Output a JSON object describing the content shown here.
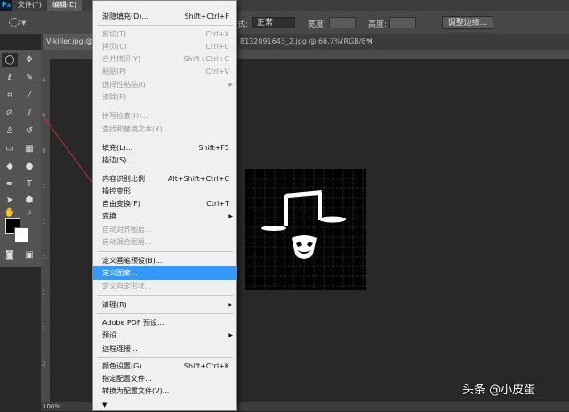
{
  "app": {
    "logo": "Ps"
  },
  "menubar": {
    "items": [
      "文件(F)",
      "编辑(E)"
    ]
  },
  "options": {
    "style_label": "样式:",
    "style_value": "正常",
    "width_label": "宽度:",
    "height_label": "高度:",
    "refine_button": "调整边缘..."
  },
  "document": {
    "tab_title": "V-killer.jpg @",
    "tab2_title": "8132091643_2.jpg @ 66.7%(RGB/8*)",
    "close": "×",
    "zoom": "100%"
  },
  "ruler": {
    "left_numbers": [
      "4",
      "6",
      "8",
      "1",
      "1",
      "1",
      "1",
      "1",
      "2"
    ]
  },
  "edit_menu": {
    "items": [
      {
        "label": "渐隐填充(D)...",
        "shortcut": "Shift+Ctrl+F",
        "state": "normal"
      },
      {
        "label": "剪切(T)",
        "shortcut": "Ctrl+X",
        "state": "disabled"
      },
      {
        "label": "拷贝(C)",
        "shortcut": "Ctrl+C",
        "state": "disabled"
      },
      {
        "label": "合并拷贝(Y)",
        "shortcut": "Shift+Ctrl+C",
        "state": "disabled"
      },
      {
        "label": "粘贴(P)",
        "shortcut": "Ctrl+V",
        "state": "disabled"
      },
      {
        "label": "选择性粘贴(I)",
        "shortcut": "",
        "state": "disabled",
        "submenu": true
      },
      {
        "label": "清除(E)",
        "shortcut": "",
        "state": "disabled"
      },
      {
        "label": "拼写检查(H)...",
        "shortcut": "",
        "state": "disabled"
      },
      {
        "label": "查找和替换文本(X)...",
        "shortcut": "",
        "state": "disabled"
      },
      {
        "label": "填充(L)...",
        "shortcut": "Shift+F5",
        "state": "normal"
      },
      {
        "label": "描边(S)...",
        "shortcut": "",
        "state": "normal"
      },
      {
        "label": "内容识别比例",
        "shortcut": "Alt+Shift+Ctrl+C",
        "state": "normal"
      },
      {
        "label": "操控变形",
        "shortcut": "",
        "state": "normal"
      },
      {
        "label": "自由变换(F)",
        "shortcut": "Ctrl+T",
        "state": "normal"
      },
      {
        "label": "变换",
        "shortcut": "",
        "state": "normal",
        "submenu": true
      },
      {
        "label": "自动对齐图层...",
        "shortcut": "",
        "state": "disabled"
      },
      {
        "label": "自动混合图层...",
        "shortcut": "",
        "state": "disabled"
      },
      {
        "label": "定义画笔预设(B)...",
        "shortcut": "",
        "state": "normal"
      },
      {
        "label": "定义图案...",
        "shortcut": "",
        "state": "highlighted"
      },
      {
        "label": "定义自定形状...",
        "shortcut": "",
        "state": "disabled"
      },
      {
        "label": "清理(R)",
        "shortcut": "",
        "state": "normal",
        "submenu": true
      },
      {
        "label": "Adobe PDF 预设...",
        "shortcut": "",
        "state": "normal"
      },
      {
        "label": "预设",
        "shortcut": "",
        "state": "normal",
        "submenu": true
      },
      {
        "label": "远程连接...",
        "shortcut": "",
        "state": "normal"
      },
      {
        "label": "颜色设置(G)...",
        "shortcut": "Shift+Ctrl+K",
        "state": "normal"
      },
      {
        "label": "指定配置文件...",
        "shortcut": "",
        "state": "normal"
      },
      {
        "label": "转换为配置文件(V)...",
        "shortcut": "",
        "state": "normal"
      }
    ],
    "more_arrow": "▼"
  },
  "watermark": "头条 @小皮蛋",
  "colors": {
    "highlight": "#3399ff",
    "annotation_arrow": "#c03030",
    "toolbar": "#535353"
  }
}
